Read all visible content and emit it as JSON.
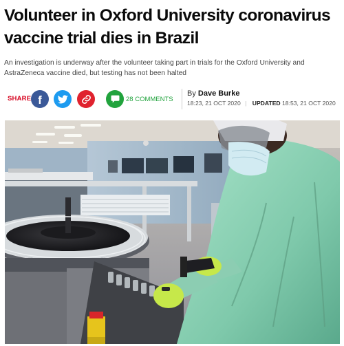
{
  "article": {
    "headline": "Volunteer in Oxford University coronavirus vaccine trial dies in Brazil",
    "standfirst": "An investigation is underway after the volunteer taking part in trials for the Oxford University and AstraZeneca vaccine died, but testing has not been halted"
  },
  "share": {
    "label": "SHARE",
    "facebook_glyph": "f",
    "comments_count": "28",
    "comments_label": "COMMENTS"
  },
  "byline": {
    "prefix": "By",
    "author": "Dave Burke",
    "published": "18:23, 21 OCT 2020",
    "updated_label": "UPDATED",
    "updated": "18:53, 21 OCT 2020"
  },
  "colors": {
    "share_red": "#d6001c",
    "facebook": "#3b5998",
    "twitter": "#1d9bf0",
    "link": "#e0222e",
    "comments": "#21a33d"
  },
  "icons": [
    "facebook-icon",
    "twitter-icon",
    "link-icon",
    "comment-icon"
  ]
}
